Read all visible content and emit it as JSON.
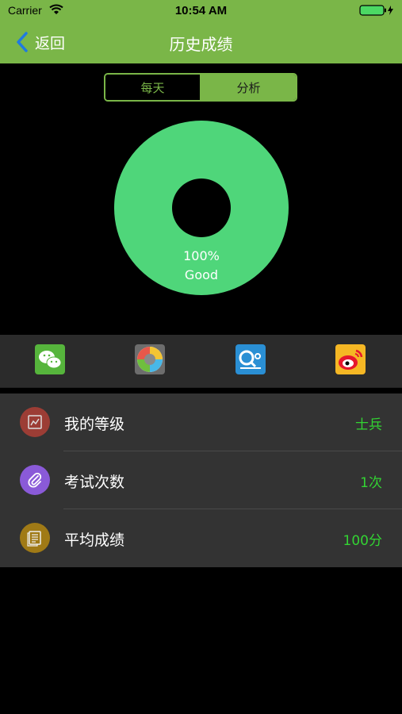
{
  "status_bar": {
    "carrier": "Carrier",
    "time": "10:54 AM"
  },
  "nav": {
    "back_label": "返回",
    "title": "历史成绩"
  },
  "segment": {
    "items": [
      "每天",
      "分析"
    ],
    "selected": "分析"
  },
  "chart_data": {
    "type": "pie",
    "categories": [
      "Good"
    ],
    "values": [
      100
    ],
    "labels": [
      "100%",
      "Good"
    ],
    "colors": [
      "#4fd67a"
    ]
  },
  "share": {
    "icons": [
      "wechat-icon",
      "moments-icon",
      "qzone-icon",
      "weibo-icon"
    ]
  },
  "list": {
    "rows": [
      {
        "label": "我的等级",
        "value": "士兵",
        "icon": "certificate-icon",
        "icon_color": "#9c3d35"
      },
      {
        "label": "考试次数",
        "value": "1次",
        "icon": "paperclip-icon",
        "icon_color": "#8a5ad8"
      },
      {
        "label": "平均成绩",
        "value": "100分",
        "icon": "document-icon",
        "icon_color": "#a07a16"
      }
    ]
  },
  "colors": {
    "brand_green": "#7ab648",
    "value_green": "#33d433",
    "list_background": "#333333"
  }
}
